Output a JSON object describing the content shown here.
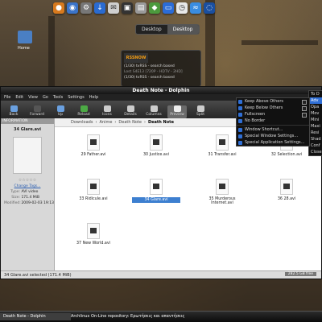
{
  "desktop": {
    "home_label": "Home",
    "switcher": [
      "Desktop",
      "Desktop"
    ],
    "rss": {
      "logo": "RSSNOW",
      "lines": [
        {
          "title": "(1/30) tvRSS - search based",
          "sub": "Lost S4E13 [720P - HDTV - 2HD]"
        },
        {
          "title": "(1/30) tvRSS - search based",
          "sub": "..."
        }
      ]
    }
  },
  "window": {
    "title": "Death Note - Dolphin",
    "menu": [
      "File",
      "Edit",
      "View",
      "Go",
      "Tools",
      "Settings",
      "Help"
    ],
    "toolbar": [
      "Back",
      "Forward",
      "Up",
      "Reload",
      "Icons",
      "Details",
      "Columns",
      "Preview",
      "Split"
    ],
    "breadcrumb": [
      "Downloads",
      "Anime",
      "Death Note",
      "Death Note"
    ],
    "info": {
      "header": "INFORMATION",
      "file_name": "34 Glare.avi",
      "change_tags": "Change Tags...",
      "type_label": "Type:",
      "type_value": "AVI video",
      "size_label": "Size:",
      "size_value": "171.4 MiB",
      "modified_label": "Modified:",
      "modified_value": "2009-02-03 19:13"
    },
    "files": [
      "29 Father.avi",
      "30 Justice.avi",
      "31 Transfer.avi",
      "32 Selection.avi",
      "33 Ridicule.avi",
      "34 Glare.avi",
      "35 Murderous Internet.avi",
      "36 28.avi",
      "37 New World.avi"
    ],
    "selected_index": 5,
    "status": "34 Glare.avi selected (171.4 MiB)",
    "free_space": "282.5 GB free"
  },
  "context_menu": {
    "items": [
      "Keep Above Others",
      "Keep Below Others",
      "Fullscreen",
      "No Border",
      "Window Shortcut...",
      "Special Window Settings...",
      "Special Application Settings..."
    ],
    "submenu": [
      "To D",
      "Adv",
      "Opa",
      "Mov",
      "Mini",
      "Maxi",
      "Resi",
      "Shad",
      "Conf",
      "Close"
    ]
  },
  "taskbar": {
    "tasks": [
      "Death Note - Dolphin",
      "Archlinux On-Line repository: Ερωτήσεις και απαντήσεις"
    ]
  }
}
